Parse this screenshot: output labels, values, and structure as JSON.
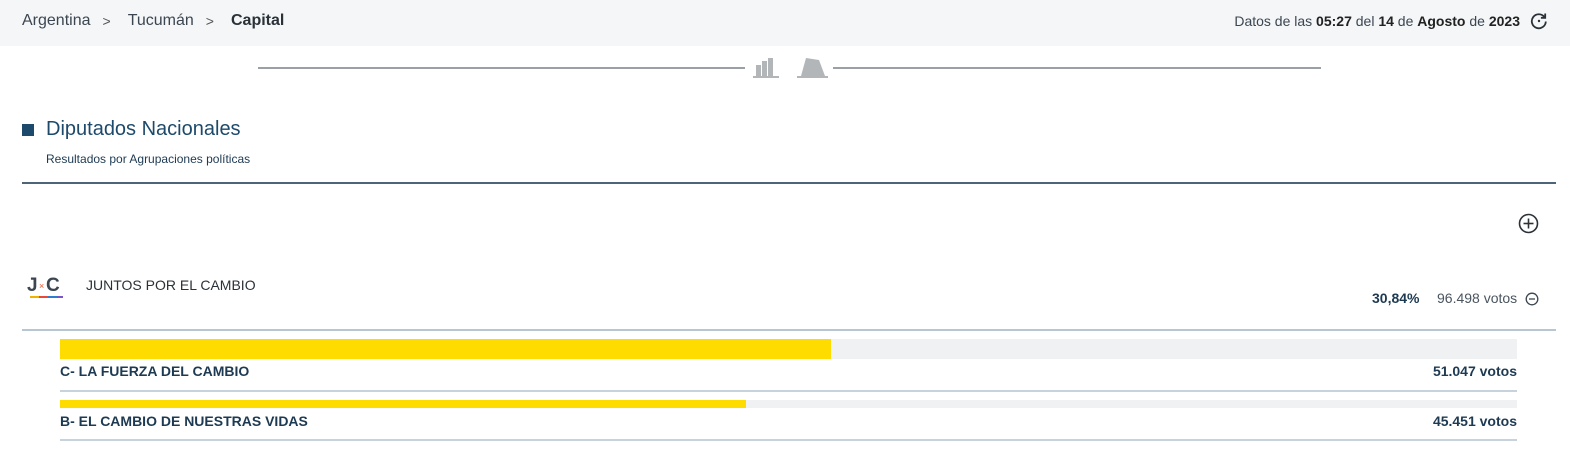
{
  "breadcrumb": {
    "items": [
      "Argentina",
      "Tucumán",
      "Capital"
    ],
    "separator": ">"
  },
  "update": {
    "prefix": "Datos de las",
    "time": "05:27",
    "mid1": "del",
    "day": "14",
    "mid2": "de",
    "month": "Agosto",
    "mid3": "de",
    "year": "2023",
    "icon": "refresh-icon"
  },
  "view_toggle": {
    "icons": [
      "bar-chart-icon",
      "ballot-box-icon"
    ]
  },
  "section": {
    "title": "Diputados Nacionales",
    "subtitle": "Resultados por Agrupaciones políticas",
    "accent_color": "#1d4a6b"
  },
  "party": {
    "name": "JUNTOS POR EL CAMBIO",
    "logo_text": "J×C",
    "percent": "30,84%",
    "votes": "96.498 votos",
    "lists": [
      {
        "name": "C- LA FUERZA DEL CAMBIO",
        "votes": "51.047 votos",
        "share": 0.529
      },
      {
        "name": "B- EL CAMBIO DE NUESTRAS VIDAS",
        "votes": "45.451 votos",
        "share": 0.471
      }
    ]
  },
  "colors": {
    "bar_fill": "#ffdc00",
    "bar_track": "#f0f1f2",
    "text_dark": "#1d3a52"
  }
}
